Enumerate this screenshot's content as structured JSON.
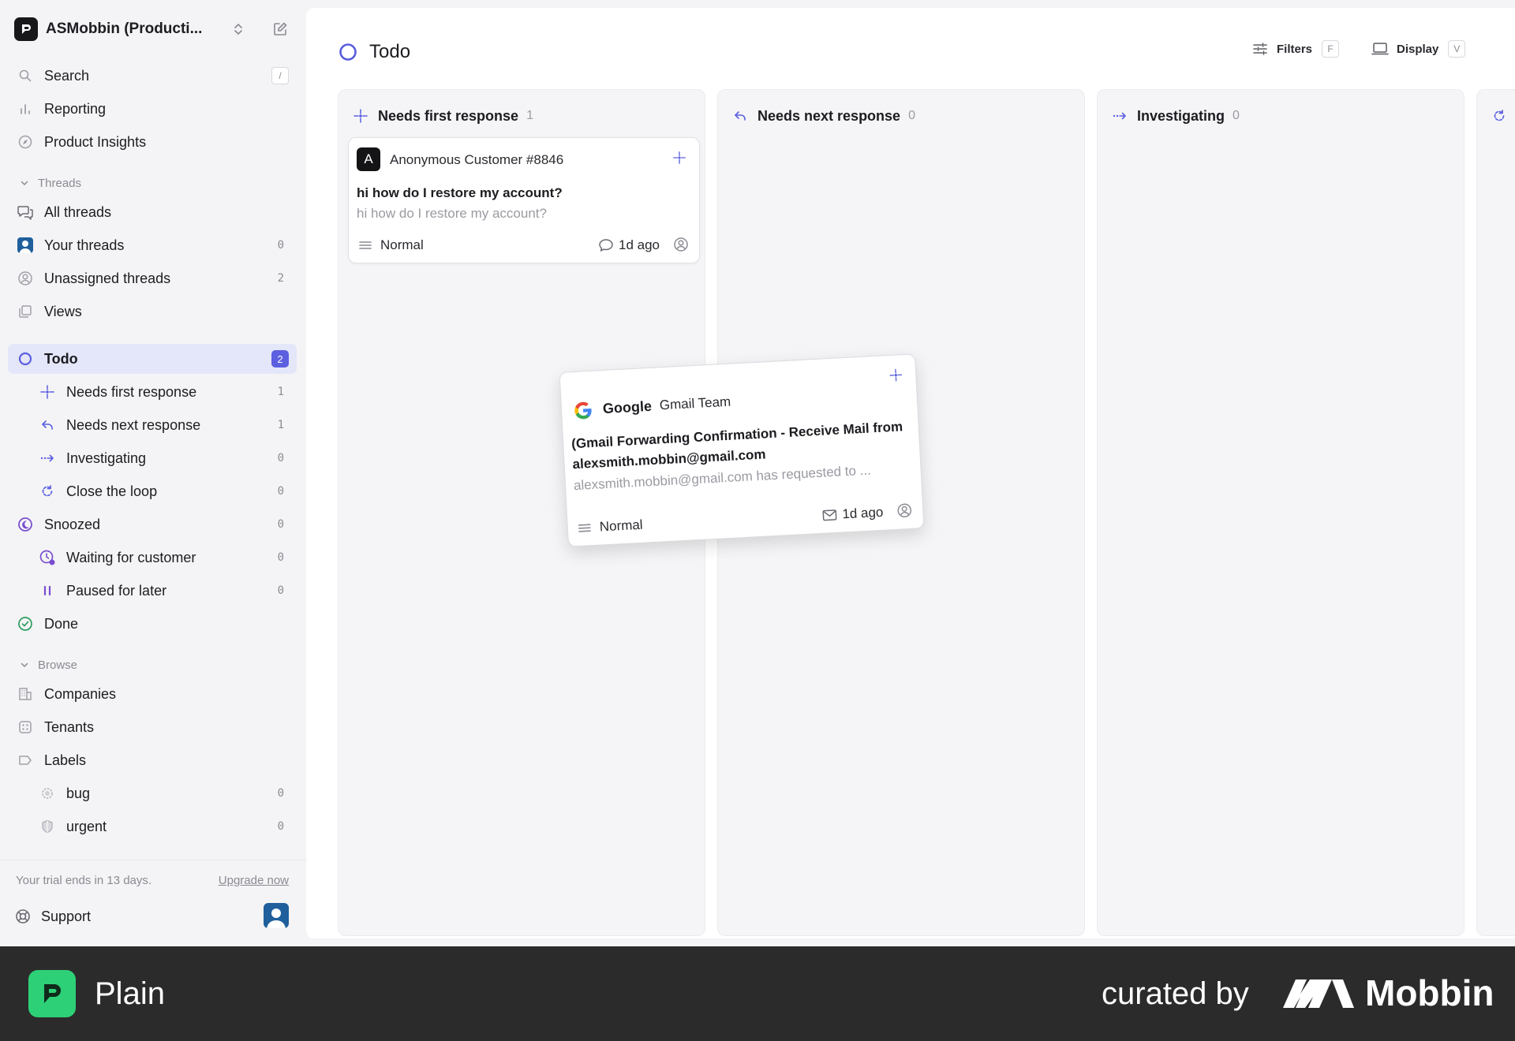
{
  "workspace": {
    "name": "ASMobbin (Producti..."
  },
  "sidebar": {
    "top": [
      {
        "label": "Search",
        "kbd": "/"
      },
      {
        "label": "Reporting"
      },
      {
        "label": "Product Insights"
      }
    ],
    "threads_section": "Threads",
    "threads": [
      {
        "label": "All threads"
      },
      {
        "label": "Your threads",
        "count": "0"
      },
      {
        "label": "Unassigned threads",
        "count": "2"
      },
      {
        "label": "Views"
      }
    ],
    "statuses": [
      {
        "label": "Todo",
        "count": "2"
      },
      {
        "label": "Needs first response",
        "count": "1"
      },
      {
        "label": "Needs next response",
        "count": "1"
      },
      {
        "label": "Investigating",
        "count": "0"
      },
      {
        "label": "Close the loop",
        "count": "0"
      },
      {
        "label": "Snoozed",
        "count": "0"
      },
      {
        "label": "Waiting for customer",
        "count": "0"
      },
      {
        "label": "Paused for later",
        "count": "0"
      },
      {
        "label": "Done"
      }
    ],
    "browse_section": "Browse",
    "browse": [
      {
        "label": "Companies"
      },
      {
        "label": "Tenants"
      },
      {
        "label": "Labels"
      },
      {
        "label": "bug",
        "count": "0"
      },
      {
        "label": "urgent",
        "count": "0"
      }
    ],
    "trial_text": "Your trial ends in 13 days.",
    "upgrade_label": "Upgrade now",
    "support_label": "Support"
  },
  "main": {
    "title": "Todo",
    "filters_label": "Filters",
    "filters_kbd": "F",
    "display_label": "Display",
    "display_kbd": "V"
  },
  "columns": [
    {
      "label": "Needs first response",
      "count": "1"
    },
    {
      "label": "Needs next response",
      "count": "0"
    },
    {
      "label": "Investigating",
      "count": "0"
    }
  ],
  "cards": [
    {
      "avatar": "A",
      "customer": "Anonymous Customer #8846",
      "title": "hi how do I restore my account?",
      "preview": "hi how do I restore my account?",
      "priority": "Normal",
      "time": "1d ago"
    }
  ],
  "drag_card": {
    "company": "Google",
    "customer": "Gmail Team",
    "title": "(Gmail Forwarding Confirmation - Receive Mail from alexsmith.mobbin@gmail.com",
    "preview": "alexsmith.mobbin@gmail.com has requested to ...",
    "priority": "Normal",
    "time": "1d ago"
  },
  "footer": {
    "brand": "Plain",
    "curated": "curated by",
    "mobbin": "Mobbin"
  },
  "colors": {
    "accent": "#5b5fe0",
    "footer_bg": "#2b2b2b",
    "plain_green": "#2ed077"
  }
}
